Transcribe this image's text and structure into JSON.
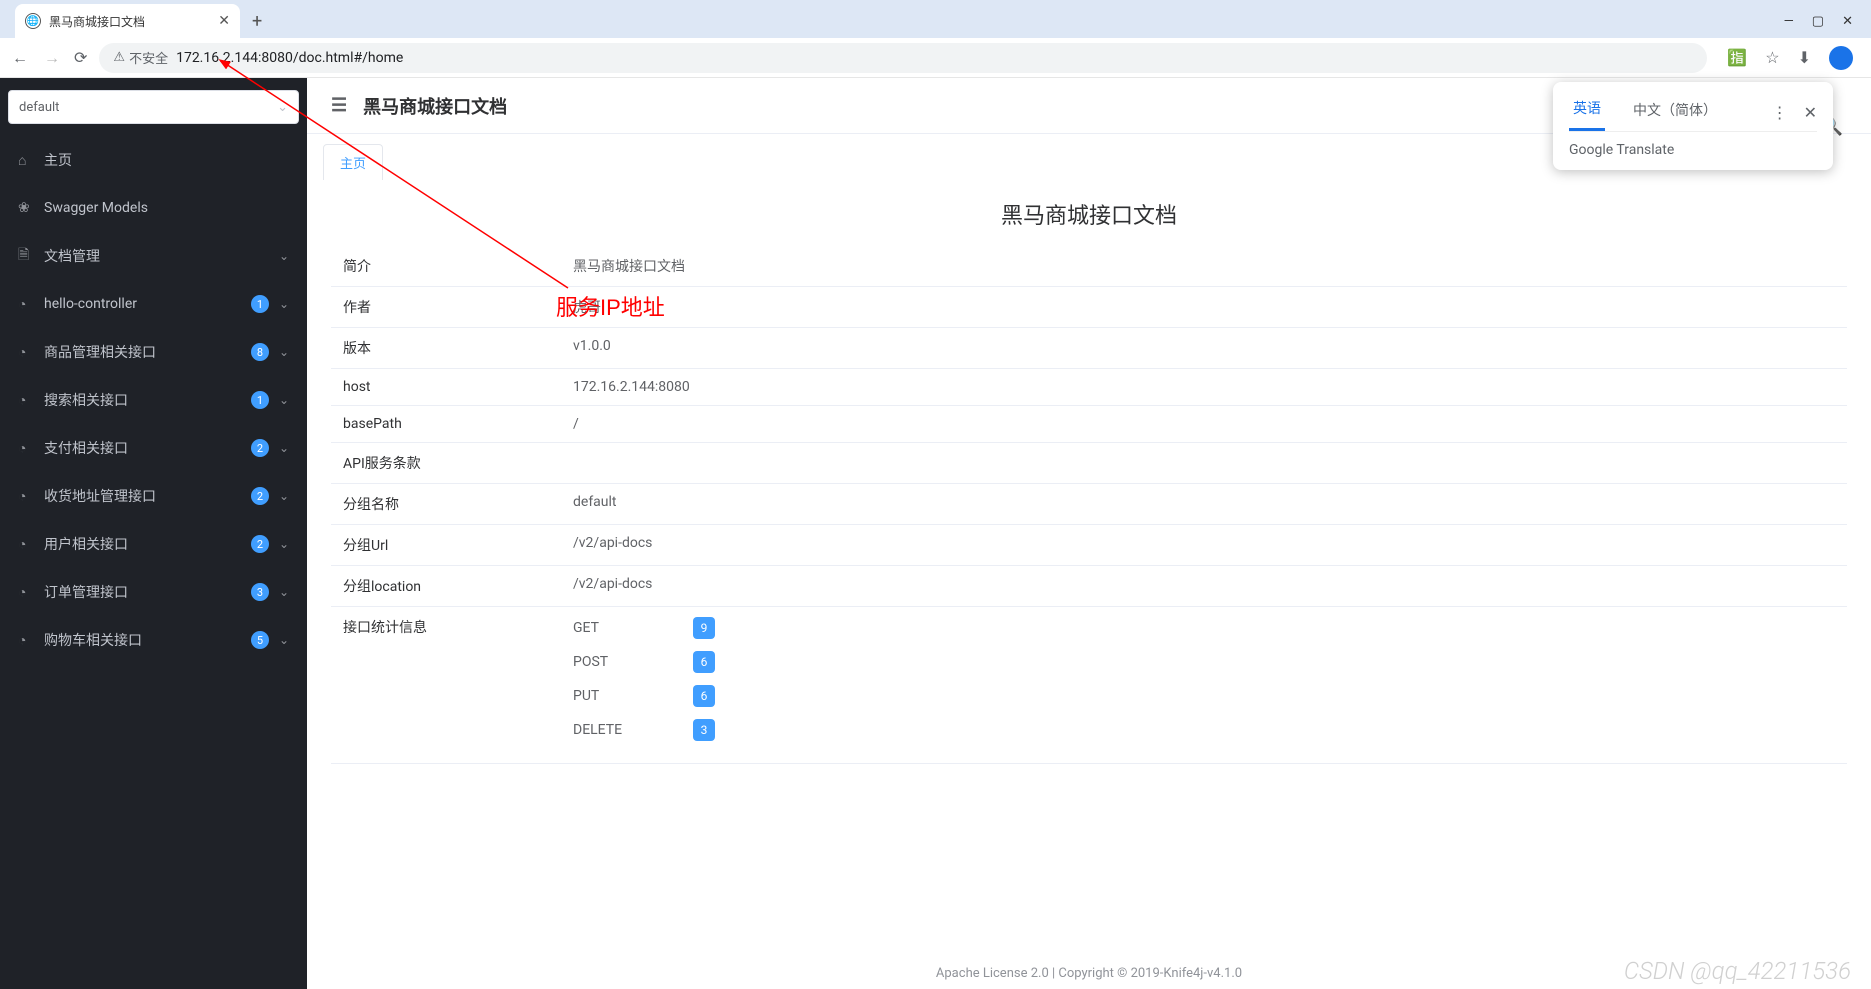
{
  "browser": {
    "tab_title": "黑马商城接口文档",
    "url": "172.16.2.144:8080/doc.html#/home",
    "security_label": "不安全"
  },
  "translate": {
    "tab1": "英语",
    "tab2": "中文（简体）",
    "brand": "Google Translate"
  },
  "sidebar": {
    "select_value": "default",
    "items": [
      {
        "icon": "⌂",
        "label": "主页",
        "badge": null,
        "expand": false
      },
      {
        "icon": "❀",
        "label": "Swagger Models",
        "badge": null,
        "expand": false
      },
      {
        "icon": "🗎",
        "label": "文档管理",
        "badge": null,
        "expand": true
      },
      {
        "icon": "◔",
        "label": "hello-controller",
        "badge": "1",
        "expand": true
      },
      {
        "icon": "◔",
        "label": "商品管理相关接口",
        "badge": "8",
        "expand": true
      },
      {
        "icon": "◔",
        "label": "搜索相关接口",
        "badge": "1",
        "expand": true
      },
      {
        "icon": "◔",
        "label": "支付相关接口",
        "badge": "2",
        "expand": true
      },
      {
        "icon": "◔",
        "label": "收货地址管理接口",
        "badge": "2",
        "expand": true
      },
      {
        "icon": "◔",
        "label": "用户相关接口",
        "badge": "2",
        "expand": true
      },
      {
        "icon": "◔",
        "label": "订单管理接口",
        "badge": "3",
        "expand": true
      },
      {
        "icon": "◔",
        "label": "购物车相关接口",
        "badge": "5",
        "expand": true
      }
    ]
  },
  "header": {
    "title": "黑马商城接口文档"
  },
  "tabs": {
    "active": "主页"
  },
  "doc": {
    "title": "黑马商城接口文档",
    "rows": [
      {
        "key": "简介",
        "val": "黑马商城接口文档"
      },
      {
        "key": "作者",
        "val": "虎哥"
      },
      {
        "key": "版本",
        "val": "v1.0.0"
      },
      {
        "key": "host",
        "val": "172.16.2.144:8080"
      },
      {
        "key": "basePath",
        "val": "/"
      },
      {
        "key": "API服务条款",
        "val": ""
      },
      {
        "key": "分组名称",
        "val": "default"
      },
      {
        "key": "分组Url",
        "val": "/v2/api-docs"
      },
      {
        "key": "分组location",
        "val": "/v2/api-docs"
      }
    ],
    "stats_label": "接口统计信息",
    "stats": [
      {
        "method": "GET",
        "count": "9"
      },
      {
        "method": "POST",
        "count": "6"
      },
      {
        "method": "PUT",
        "count": "6"
      },
      {
        "method": "DELETE",
        "count": "3"
      }
    ]
  },
  "annotation": {
    "text": "服务IP地址"
  },
  "footer": "Apache License 2.0 | Copyright © 2019-Knife4j-v4.1.0",
  "watermark": "CSDN @qq_42211536"
}
